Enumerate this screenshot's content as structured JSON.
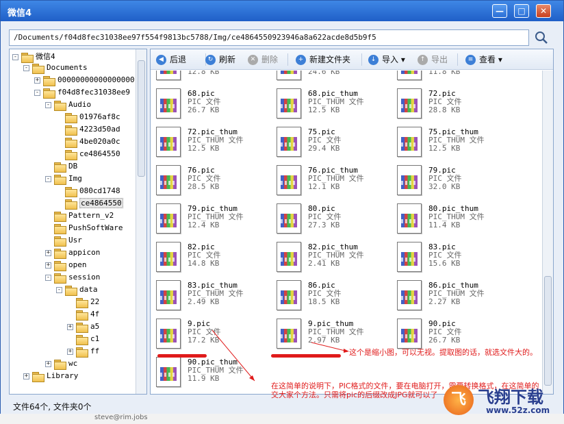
{
  "window": {
    "title": "微信4",
    "minimize": "—",
    "maximize": "□",
    "close": "✕"
  },
  "path": "/Documents/f04d8fec31038ee97f554f9813bc5788/Img/ce4864550923946a8a622acde8d5b9f5",
  "tree": [
    {
      "label": "微信4",
      "depth": 0,
      "expander": "-",
      "selected": false
    },
    {
      "label": "Documents",
      "depth": 1,
      "expander": "-",
      "selected": false
    },
    {
      "label": "00000000000000000",
      "depth": 2,
      "expander": "+",
      "selected": false
    },
    {
      "label": "f04d8fec31038ee9",
      "depth": 2,
      "expander": "-",
      "selected": false
    },
    {
      "label": "Audio",
      "depth": 3,
      "expander": "-",
      "selected": false
    },
    {
      "label": "01976af8c",
      "depth": 4,
      "expander": "",
      "selected": false
    },
    {
      "label": "4223d50ad",
      "depth": 4,
      "expander": "",
      "selected": false
    },
    {
      "label": "4be020a0c",
      "depth": 4,
      "expander": "",
      "selected": false
    },
    {
      "label": "ce4864550",
      "depth": 4,
      "expander": "",
      "selected": false
    },
    {
      "label": "DB",
      "depth": 3,
      "expander": "",
      "selected": false
    },
    {
      "label": "Img",
      "depth": 3,
      "expander": "-",
      "selected": false
    },
    {
      "label": "080cd1748",
      "depth": 4,
      "expander": "",
      "selected": false
    },
    {
      "label": "ce4864550",
      "depth": 4,
      "expander": "",
      "selected": true
    },
    {
      "label": "Pattern_v2",
      "depth": 3,
      "expander": "",
      "selected": false
    },
    {
      "label": "PushSoftWare",
      "depth": 3,
      "expander": "",
      "selected": false
    },
    {
      "label": "Usr",
      "depth": 3,
      "expander": "",
      "selected": false
    },
    {
      "label": "appicon",
      "depth": 3,
      "expander": "+",
      "selected": false
    },
    {
      "label": "open",
      "depth": 3,
      "expander": "+",
      "selected": false
    },
    {
      "label": "session",
      "depth": 3,
      "expander": "-",
      "selected": false
    },
    {
      "label": "data",
      "depth": 4,
      "expander": "-",
      "selected": false
    },
    {
      "label": "22",
      "depth": 5,
      "expander": "",
      "selected": false
    },
    {
      "label": "4f",
      "depth": 5,
      "expander": "",
      "selected": false
    },
    {
      "label": "a5",
      "depth": 5,
      "expander": "+",
      "selected": false
    },
    {
      "label": "c1",
      "depth": 5,
      "expander": "",
      "selected": false
    },
    {
      "label": "ff",
      "depth": 5,
      "expander": "+",
      "selected": false
    },
    {
      "label": "wc",
      "depth": 3,
      "expander": "+",
      "selected": false
    },
    {
      "label": "Library",
      "depth": 1,
      "expander": "+",
      "selected": false
    }
  ],
  "toolbar": {
    "back": "后退",
    "refresh": "刷新",
    "delete": "删除",
    "new_folder": "新建文件夹",
    "import": "导入",
    "export": "导出",
    "view": "查看"
  },
  "files": [
    {
      "name": "",
      "type": "",
      "size": "12.8 KB"
    },
    {
      "name": "",
      "type": "",
      "size": "24.6 KB"
    },
    {
      "name": "",
      "type": "",
      "size": "11.8 KB"
    },
    {
      "name": "68.pic",
      "type": "PIC 文件",
      "size": "26.7 KB"
    },
    {
      "name": "68.pic_thum",
      "type": "PIC_THUM 文件",
      "size": "12.5 KB"
    },
    {
      "name": "72.pic",
      "type": "PIC 文件",
      "size": "28.8 KB"
    },
    {
      "name": "72.pic_thum",
      "type": "PIC_THUM 文件",
      "size": "12.5 KB"
    },
    {
      "name": "75.pic",
      "type": "PIC 文件",
      "size": "29.4 KB"
    },
    {
      "name": "75.pic_thum",
      "type": "PIC_THUM 文件",
      "size": "12.5 KB"
    },
    {
      "name": "76.pic",
      "type": "PIC 文件",
      "size": "28.5 KB"
    },
    {
      "name": "76.pic_thum",
      "type": "PIC_THUM 文件",
      "size": "12.1 KB"
    },
    {
      "name": "79.pic",
      "type": "PIC 文件",
      "size": "32.0 KB"
    },
    {
      "name": "79.pic_thum",
      "type": "PIC_THUM 文件",
      "size": "12.4 KB"
    },
    {
      "name": "80.pic",
      "type": "PIC 文件",
      "size": "27.3 KB"
    },
    {
      "name": "80.pic_thum",
      "type": "PIC_THUM 文件",
      "size": "11.4 KB"
    },
    {
      "name": "82.pic",
      "type": "PIC 文件",
      "size": "14.8 KB"
    },
    {
      "name": "82.pic_thum",
      "type": "PIC_THUM 文件",
      "size": "2.41 KB"
    },
    {
      "name": "83.pic",
      "type": "PIC 文件",
      "size": "15.6 KB"
    },
    {
      "name": "83.pic_thum",
      "type": "PIC_THUM 文件",
      "size": "2.49 KB"
    },
    {
      "name": "86.pic",
      "type": "PIC 文件",
      "size": "18.5 KB"
    },
    {
      "name": "86.pic_thum",
      "type": "PIC_THUM 文件",
      "size": "2.27 KB"
    },
    {
      "name": "9.pic",
      "type": "PIC 文件",
      "size": "17.2 KB"
    },
    {
      "name": "9.pic_thum",
      "type": "PIC_THUM 文件",
      "size": "2.97 KB"
    },
    {
      "name": "90.pic",
      "type": "PIC 文件",
      "size": "26.7 KB"
    },
    {
      "name": "90.pic_thum",
      "type": "PIC_THUM 文件",
      "size": "11.9 KB"
    }
  ],
  "status": "文件64个, 文件夹0个",
  "annotations": {
    "thumb_note": "这个是缩小图，可以无视。提取图的话，就选文件大的。",
    "instructions_line1": "在这简单的说明下，PIC格式的文件，要在电脑打开，需要转换格式，在这简单的",
    "instructions_line2": "交大家个方法。只需将pic的后缀改成JPG就可以了"
  },
  "logo": {
    "mark": "飞",
    "name": "飞翔下载",
    "url": "www.52z.com"
  },
  "background_text": "steve@rim.jobs",
  "colors": {
    "annotation": "#e01b1b",
    "titlebar": "#2b6fd6",
    "accent": "#3d7fd6"
  }
}
